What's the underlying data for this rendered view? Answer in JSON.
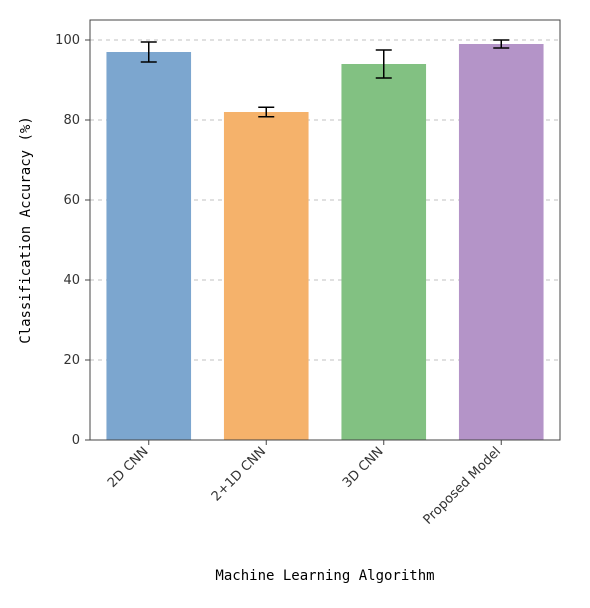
{
  "chart_data": {
    "type": "bar",
    "categories": [
      "2D CNN",
      "2+1D CNN",
      "3D CNN",
      "Proposed Model"
    ],
    "values": [
      97,
      82,
      94,
      99
    ],
    "errors": [
      2.5,
      1.2,
      3.5,
      1.0
    ],
    "colors": [
      "#7ca6cf",
      "#f5b26b",
      "#82c182",
      "#b494c8"
    ],
    "title": "",
    "xlabel": "Machine Learning Algorithm",
    "ylabel": "Classification Accuracy (%)",
    "ylim": [
      0,
      105
    ],
    "yticks": [
      0,
      20,
      40,
      60,
      80,
      100
    ]
  }
}
